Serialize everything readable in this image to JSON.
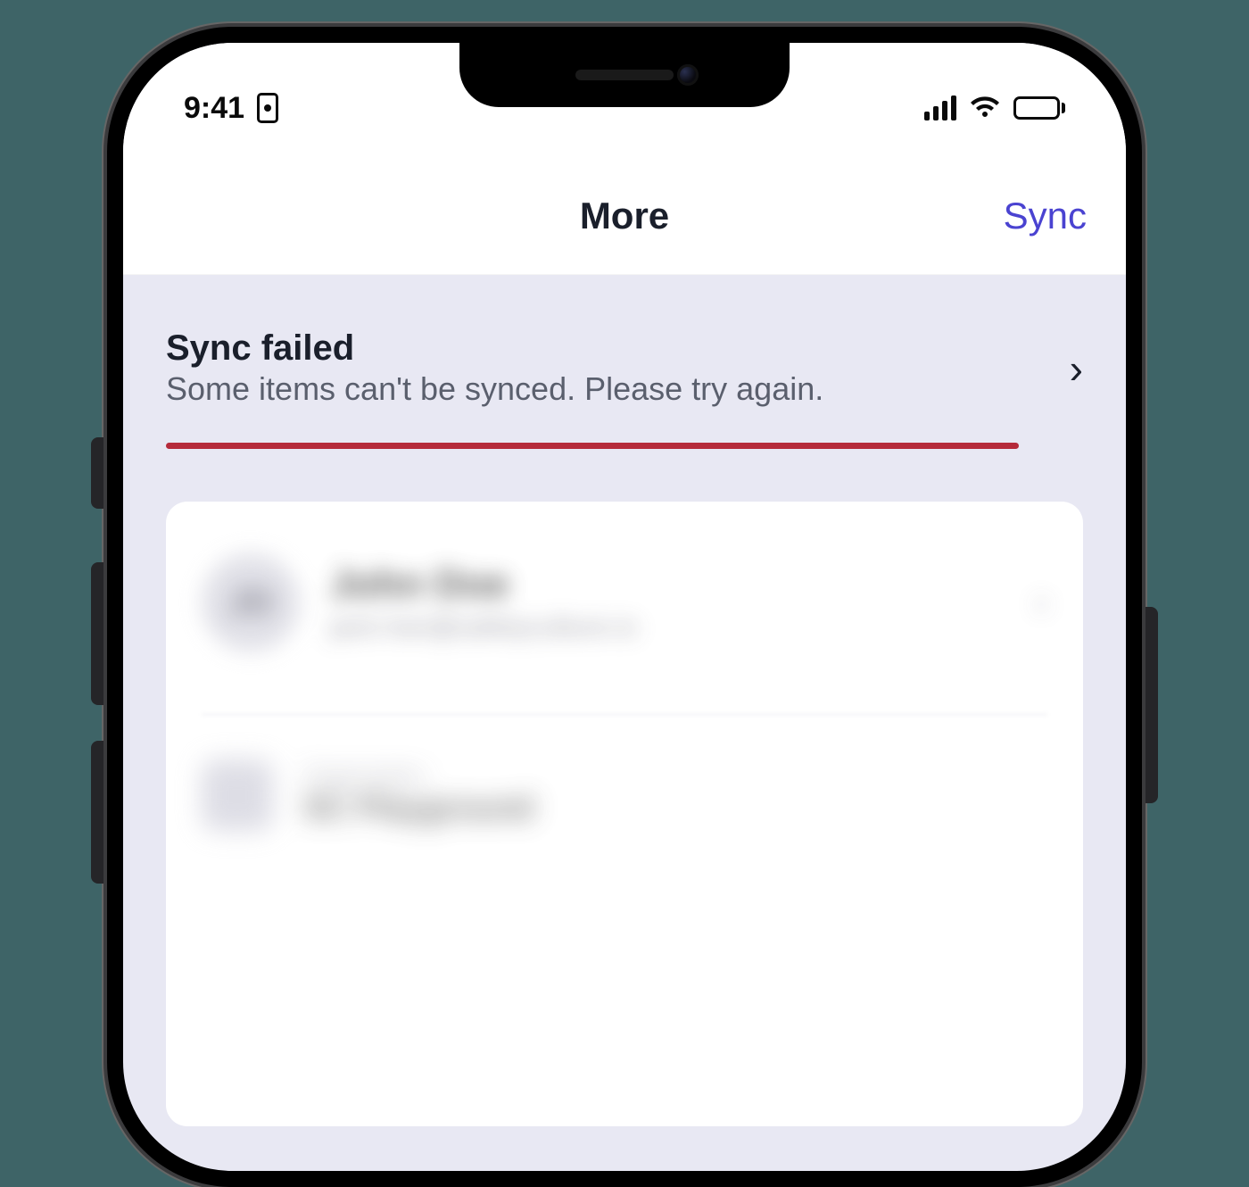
{
  "status": {
    "time": "9:41"
  },
  "header": {
    "title": "More",
    "sync_action": "Sync"
  },
  "banner": {
    "title": "Sync failed",
    "message": "Some items can't be synced. Please try again.",
    "underline_color": "#b52a3a"
  },
  "profile": {
    "initials": "JD",
    "name": "John Doe",
    "email": "jack.han@safetyculture.io"
  },
  "org": {
    "label": "Organization",
    "value": "SC Playground"
  },
  "colors": {
    "accent": "#4a43d1",
    "bg": "#e8e8f3"
  }
}
